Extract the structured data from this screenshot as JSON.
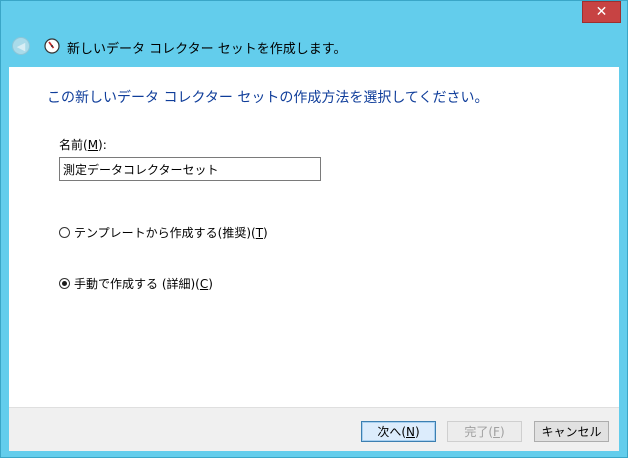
{
  "window": {
    "close_label": "✕",
    "wizard_title": "新しいデータ コレクター セットを作成します。"
  },
  "content": {
    "heading": "この新しいデータ コレクター セットの作成方法を選択してください。",
    "name_label_prefix": "名前(",
    "name_label_key": "M",
    "name_label_suffix": "):",
    "name_value": "測定データコレクターセット",
    "options": [
      {
        "label": "テンプレートから作成する(推奨)(",
        "key": "T",
        "suffix": ")",
        "selected": false
      },
      {
        "label": "手動で作成する (詳細)(",
        "key": "C",
        "suffix": ")",
        "selected": true
      }
    ]
  },
  "footer": {
    "next_prefix": "次へ(",
    "next_key": "N",
    "next_suffix": ")",
    "finish_prefix": "完了(",
    "finish_key": "F",
    "finish_suffix": ")",
    "cancel_label": "キャンセル"
  },
  "colors": {
    "frame": "#63cdec",
    "heading": "#0f3d9a",
    "close": "#c74343"
  }
}
